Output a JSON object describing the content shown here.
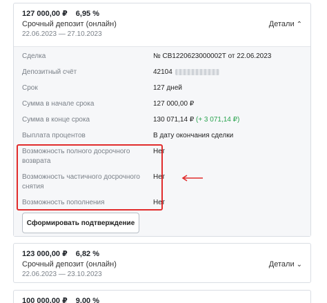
{
  "deposits": [
    {
      "amount": "127 000,00 ₽",
      "rate": "6,95 %",
      "type": "Срочный депозит (онлайн)",
      "period": "22.06.2023 — 27.10.2023",
      "details_label": "Детали",
      "details_chevron": "⌃",
      "rows": {
        "deal": {
          "label": "Сделка",
          "value": "№ СВ1220623000002Т от 22.06.2023"
        },
        "account": {
          "label": "Депозитный счёт",
          "value": "42104"
        },
        "term": {
          "label": "Срок",
          "value": "127 дней"
        },
        "start_sum": {
          "label": "Сумма в начале срока",
          "value": "127 000,00 ₽"
        },
        "end_sum": {
          "label": "Сумма в конце срока",
          "value": "130 071,14 ₽",
          "gain": "(+ 3 071,14 ₽)"
        },
        "interest": {
          "label": "Выплата процентов",
          "value": "В дату окончания сделки"
        },
        "full_return": {
          "label": "Возможность полного досрочного возврата",
          "value": "Нет"
        },
        "partial_withdraw": {
          "label": "Возможность частичного досрочного снятия",
          "value": "Нет"
        },
        "topup": {
          "label": "Возможность пополнения",
          "value": "Нет"
        }
      },
      "confirm_button": "Сформировать подтверждение"
    },
    {
      "amount": "123 000,00 ₽",
      "rate": "6,82 %",
      "type": "Срочный депозит (онлайн)",
      "period": "22.06.2023 — 23.10.2023",
      "details_label": "Детали",
      "details_chevron": "⌄"
    },
    {
      "amount": "100 000,00 ₽",
      "rate": "9,00 %"
    }
  ],
  "colors": {
    "highlight": "#e12b2b",
    "gain": "#2aa44f"
  }
}
